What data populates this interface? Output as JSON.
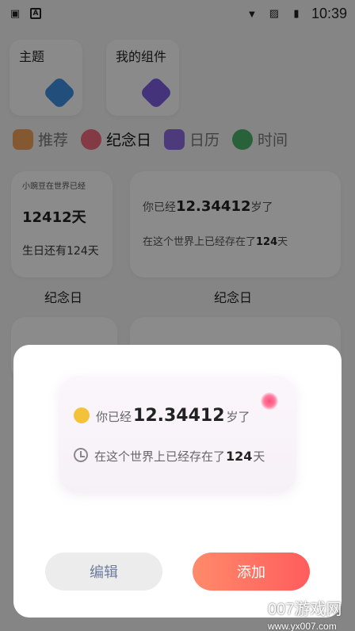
{
  "status_bar": {
    "time": "10:39"
  },
  "tools": [
    {
      "label": "主题",
      "icon": "theme-icon",
      "color": "#3f8fe0"
    },
    {
      "label": "我的组件",
      "icon": "widget-icon",
      "color": "#7c5ce0"
    }
  ],
  "tabs": [
    {
      "label": "推荐",
      "icon": "recommend-icon",
      "color": "#f1a35b"
    },
    {
      "label": "纪念日",
      "icon": "heart-icon",
      "color": "#ef6a7c",
      "active": true
    },
    {
      "label": "日历",
      "icon": "calendar-icon",
      "color": "#8d6ae0"
    },
    {
      "label": "时间",
      "icon": "clock-icon",
      "color": "#4bb36a"
    }
  ],
  "widgets": {
    "small": {
      "top_label": "小豌豆在世界已经",
      "days": "12412天",
      "birthday": "生日还有124天"
    },
    "large": {
      "age_prefix": "你已经",
      "age_value": "12.34412",
      "age_suffix": "岁了",
      "exist_prefix": "在这个世界上已经存在了",
      "exist_value": "124",
      "exist_suffix": "天"
    },
    "caption_small": "纪念日",
    "caption_large": "纪念日"
  },
  "dialog": {
    "age_prefix": "你已经",
    "age_value": "12.34412",
    "age_suffix": "岁了",
    "exist_prefix": "在这个世界上已经存在了",
    "exist_value": "124",
    "exist_suffix": "天",
    "edit_label": "编辑",
    "add_label": "添加"
  },
  "watermark": {
    "line1": "007游戏网",
    "line2": "www.yx007.com"
  }
}
